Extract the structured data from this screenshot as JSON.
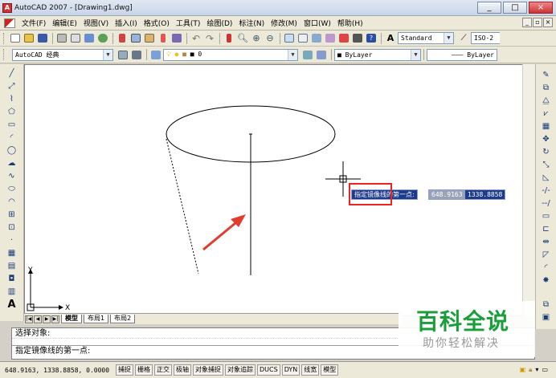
{
  "window": {
    "title": "AutoCAD 2007 - [Drawing1.dwg]",
    "controls": [
      "_",
      "□",
      "×"
    ]
  },
  "menubar": {
    "items": [
      "文件(F)",
      "编辑(E)",
      "视图(V)",
      "插入(I)",
      "格式(O)",
      "工具(T)",
      "绘图(D)",
      "标注(N)",
      "修改(M)",
      "窗口(W)",
      "帮助(H)"
    ],
    "mdi_controls": [
      "_",
      "▫",
      "×"
    ]
  },
  "toolbar1": {
    "text_style": "Standard",
    "dim_style": "ISO-2"
  },
  "toolbar2": {
    "workspace": "AutoCAD 经典",
    "layer": "0",
    "color": "ByLayer",
    "linetype": "ByLayer"
  },
  "layout_tabs": [
    "模型",
    "布局1",
    "布局2"
  ],
  "ucs": {
    "x_label": "X",
    "y_label": "Y"
  },
  "dynamic_input": {
    "prompt": "指定镜像线的第一点:",
    "x_value": "648.9163",
    "y_value": "1338.8858"
  },
  "command": {
    "history": "选择对象:",
    "current": "指定镜像线的第一点:"
  },
  "status": {
    "coords": "648.9163, 1338.8858, 0.0000",
    "toggles": [
      "捕捉",
      "栅格",
      "正交",
      "极轴",
      "对象捕捉",
      "对象追踪",
      "DUCS",
      "DYN",
      "线宽",
      "模型"
    ]
  },
  "watermark": {
    "title": "百科全说",
    "subtitle": "助你轻松解决"
  },
  "colors": {
    "dyn_bg": "#1e3a8a",
    "highlight": "#e22222",
    "watermark_green": "#1a9e3b",
    "arrow_red": "#e23b2f"
  }
}
